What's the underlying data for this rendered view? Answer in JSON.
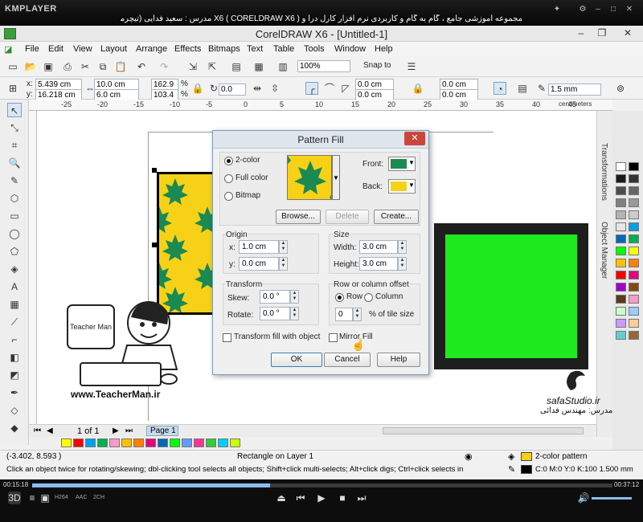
{
  "player": {
    "brand": "KMPLAYER",
    "caption": "مجموعه آموزشی جامع ، گام به گام و کاربردی نرم افزار کارل درا و X6 ( CORELDRAW X6 ) مدرس : سعید فدایی (تیچرمن) گروه آموزشی پادشاه گرافیست ها",
    "time_elapsed": "00:15:18",
    "time_total": "00:37:12",
    "progress": 0.41,
    "tags": [
      "H264",
      "AAC",
      "2CH"
    ]
  },
  "app": {
    "title": "CorelDRAW X6 - [Untitled-1]",
    "menu": [
      "File",
      "Edit",
      "View",
      "Layout",
      "Arrange",
      "Effects",
      "Bitmaps",
      "Text",
      "Table",
      "Tools",
      "Window",
      "Help"
    ],
    "zoom": "100%",
    "snap": "Snap to"
  },
  "propbar": {
    "x": "5.439 cm",
    "y": "16.218 cm",
    "w": "10.0 cm",
    "h": "6.0 cm",
    "scale_x": "162.9",
    "scale_y": "103.4",
    "pct": "%",
    "angle": "0.0",
    "corner1": "0.0 cm",
    "corner2": "0.0 cm",
    "corner3": "0.0 cm",
    "corner4": "0.0 cm",
    "outline": "1.5 mm",
    "ruler_unit": "centimeters"
  },
  "ruler": {
    "top": [
      "-25",
      "-20",
      "-15",
      "-10",
      "-5",
      "0",
      "5",
      "10",
      "15",
      "20",
      "25",
      "30",
      "35",
      "40",
      "45"
    ]
  },
  "dialog": {
    "title": "Pattern Fill",
    "opt_2color": "2-color",
    "opt_fullcolor": "Full color",
    "opt_bitmap": "Bitmap",
    "front_label": "Front:",
    "back_label": "Back:",
    "front_color": "#1a8a52",
    "back_color": "#f7d117",
    "browse": "Browse...",
    "delete": "Delete",
    "create": "Create...",
    "origin_title": "Origin",
    "origin_x_label": "x:",
    "origin_x": "1.0 cm",
    "origin_y_label": "y:",
    "origin_y": "0.0 cm",
    "size_title": "Size",
    "width_label": "Width:",
    "width": "3.0 cm",
    "height_label": "Height:",
    "height": "3.0 cm",
    "transform_title": "Transform",
    "skew_label": "Skew:",
    "skew": "0.0 °",
    "rotate_label": "Rotate:",
    "rotate": "0.0 °",
    "offset_title": "Row or column offset",
    "row": "Row",
    "column": "Column",
    "offset_value": "0",
    "offset_unit": "% of tile size",
    "transform_fill": "Transform fill with object",
    "mirror_fill": "Mirror Fill",
    "ok": "OK",
    "cancel": "Cancel",
    "help": "Help"
  },
  "docker": {
    "transformations": "Transformations",
    "object_manager": "Object Manager"
  },
  "pager": {
    "count": "1 of 1",
    "page_tab": "Page 1"
  },
  "status": {
    "coords": "(-3.402, 8.593 )",
    "selection": "Rectangle on Layer 1",
    "hint": "Click an object twice for rotating/skewing; dbl-clicking tool selects all objects; Shift+click multi-selects; Alt+click digs; Ctrl+click selects in a group",
    "fill": "2-color pattern",
    "outline": "C:0 M:0 Y:0 K:100  1.500 mm"
  },
  "watermark": {
    "url": "www.TeacherMan.ir",
    "safa": "safaStudio.ir",
    "teacher_name": "Teacher Man",
    "safa_teacher": "مدرس: مهندس فدائی"
  },
  "palette_colors": [
    "#ffffff",
    "#000000",
    "#1a1a1a",
    "#333333",
    "#4d4d4d",
    "#666666",
    "#808080",
    "#999999",
    "#b3b3b3",
    "#cccccc",
    "#e6e6e6",
    "#00a0e9",
    "#0068b7",
    "#00b050",
    "#00ff00",
    "#ffff00",
    "#ffc000",
    "#ff8000",
    "#ff0000",
    "#e4007f",
    "#a000c8",
    "#8b4513",
    "#5a3a1e",
    "#ff99cc",
    "#ccffcc",
    "#99ccff",
    "#cc99ff",
    "#ffcc99",
    "#66cccc",
    "#996633"
  ],
  "doc_palette": [
    "#ffff00",
    "#ff0000",
    "#00a0e9",
    "#00b050",
    "#ff99cc",
    "#ffc000",
    "#ff8000",
    "#e4007f",
    "#0068b7",
    "#00ff00",
    "#6699ff",
    "#ff3399",
    "#33cc33",
    "#00ccff",
    "#ccff00"
  ]
}
